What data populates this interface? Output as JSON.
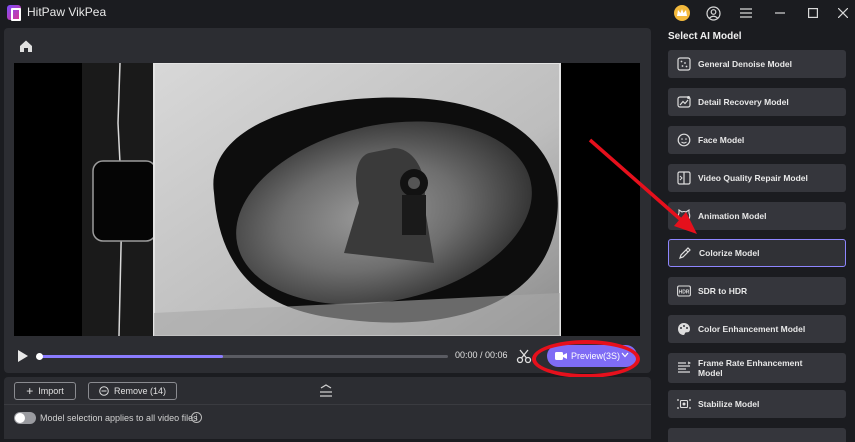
{
  "app": {
    "title": "HitPaw VikPea"
  },
  "player": {
    "time": "00:00 / 00:06",
    "progress": 0.45,
    "preview_label": "Preview(3S)"
  },
  "toolbar": {
    "import_label": "Import",
    "remove_label": "Remove (14)"
  },
  "options": {
    "apply_all_label": "Model selection applies to all video files"
  },
  "sidebar": {
    "title": "Select AI Model",
    "models": [
      {
        "label": "General Denoise Model"
      },
      {
        "label": "Detail Recovery Model"
      },
      {
        "label": "Face Model"
      },
      {
        "label": "Video Quality Repair Model"
      },
      {
        "label": "Animation Model"
      },
      {
        "label": "Colorize Model"
      },
      {
        "label": "SDR to HDR"
      },
      {
        "label": "Color Enhancement Model"
      },
      {
        "label": "Frame Rate Enhancement Model"
      },
      {
        "label": "Stabilize Model"
      }
    ],
    "selected": "Colorize Model"
  },
  "colors": {
    "accent": "#7f6cf5",
    "annotation": "#e6101c",
    "panel": "#2c2d32",
    "background": "#1b1c20"
  }
}
